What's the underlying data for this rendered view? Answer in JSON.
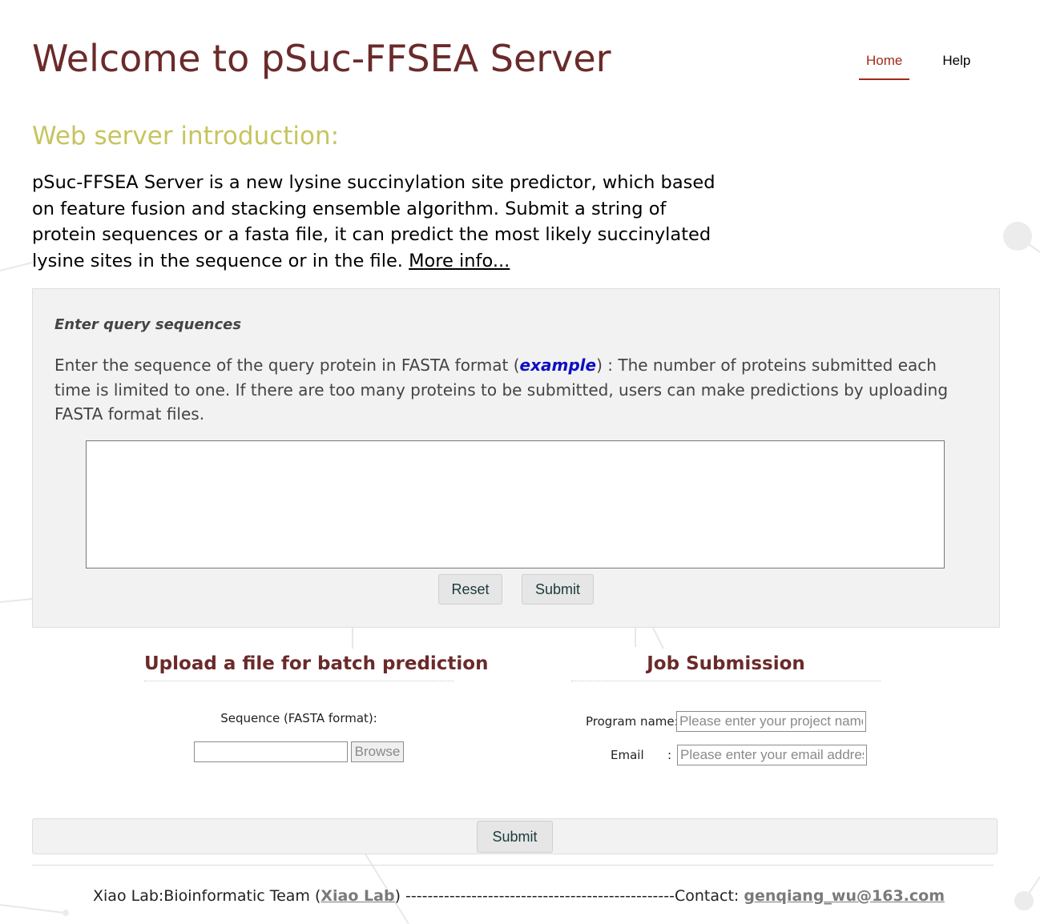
{
  "header": {
    "title": "Welcome to pSuc-FFSEA Server",
    "nav": [
      {
        "label": "Home",
        "active": true
      },
      {
        "label": "Help",
        "active": false
      }
    ],
    "active_color": "#a12b1a"
  },
  "intro": {
    "heading": "Web server introduction:",
    "text": "pSuc-FFSEA Server is a new lysine succinylation site predictor, which based on feature fusion and stacking ensemble algorithm. Submit a string of protein sequences or a fasta file, it can predict the most likely succinylated lysine sites in the sequence or in the file. ",
    "more_info_link": "More info..."
  },
  "query": {
    "label": "Enter query sequences",
    "desc_before": "Enter the sequence of the query protein in FASTA format (",
    "example_link": "example",
    "desc_after": ") : The number of proteins submitted each time is limited to one. If there are too many proteins to be submitted, users can make predictions by uploading FASTA format files.",
    "textarea_value": "",
    "reset_label": "Reset",
    "submit_label": "Submit"
  },
  "upload": {
    "heading": "Upload a file for batch prediction",
    "fasta_label": "Sequence (FASTA format):",
    "browse_label": "Browse"
  },
  "job": {
    "heading": "Job Submission",
    "program_name_label": "Program name:",
    "program_name_placeholder": "Please enter your project name",
    "email_label": "Email",
    "email_colon": ":",
    "email_placeholder": "Please enter your email address"
  },
  "submit_bar": {
    "submit_label": "Submit"
  },
  "footer": {
    "prefix": "Xiao Lab:Bioinformatic Team (",
    "lab_link": "Xiao Lab",
    "middle": ") -------------------------------------------------Contact: ",
    "contact_email": "genqiang_wu@163.com"
  },
  "colors": {
    "title": "#6b2a2a",
    "intro_heading": "#c7c45e",
    "example_link": "#0e0ec4",
    "panel_bg": "#f2f2f2"
  }
}
